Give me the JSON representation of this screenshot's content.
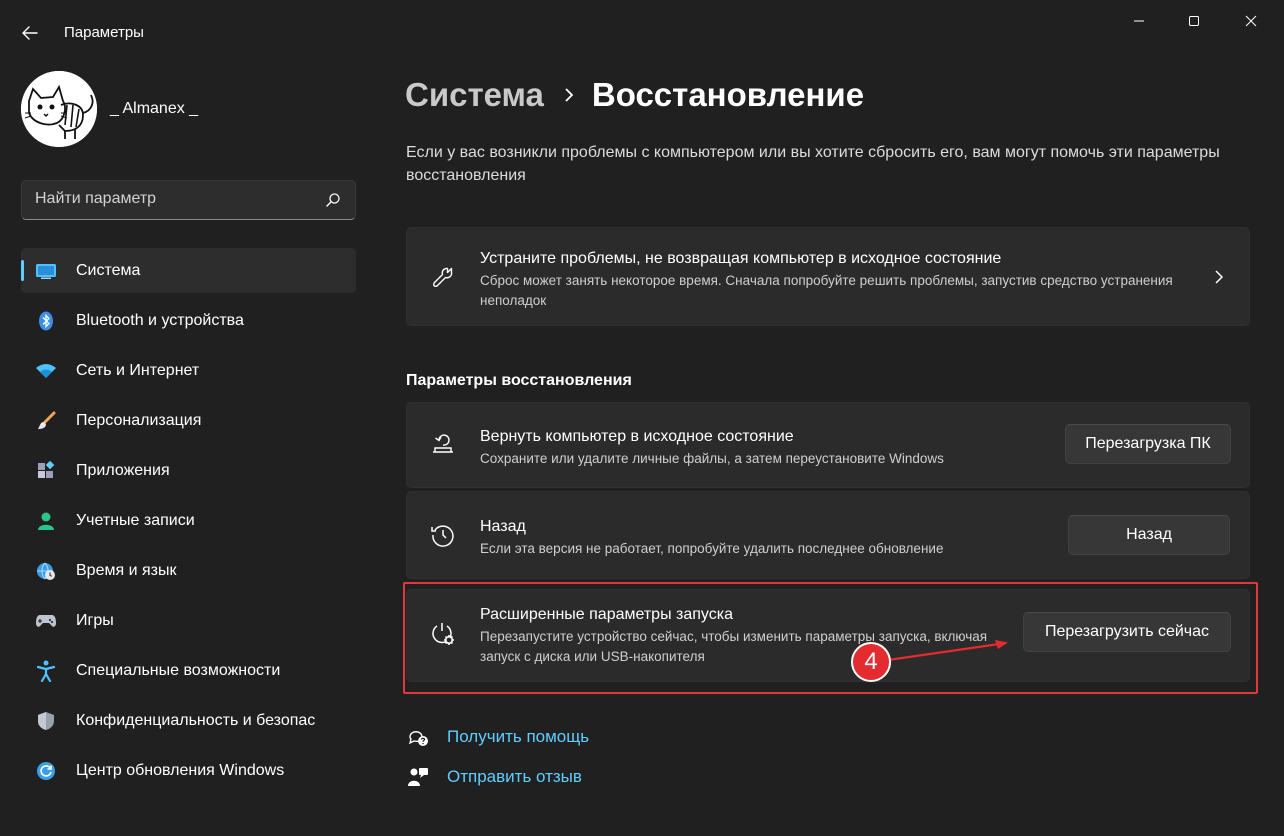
{
  "window": {
    "title": "Параметры",
    "controls": [
      "minimize",
      "maximize",
      "close"
    ]
  },
  "profile": {
    "name": "_ Almanex _"
  },
  "search": {
    "placeholder": "Найти параметр"
  },
  "sidebar": {
    "items": [
      {
        "label": "Система",
        "icon": "system-display-icon",
        "active": true
      },
      {
        "label": "Bluetooth и устройства",
        "icon": "bluetooth-icon"
      },
      {
        "label": "Сеть и Интернет",
        "icon": "wifi-icon"
      },
      {
        "label": "Персонализация",
        "icon": "brush-icon"
      },
      {
        "label": "Приложения",
        "icon": "apps-icon"
      },
      {
        "label": "Учетные записи",
        "icon": "user-icon"
      },
      {
        "label": "Время и язык",
        "icon": "globe-clock-icon"
      },
      {
        "label": "Игры",
        "icon": "gamepad-icon"
      },
      {
        "label": "Специальные возможности",
        "icon": "accessibility-icon"
      },
      {
        "label": "Конфиденциальность и безопас",
        "icon": "shield-icon"
      },
      {
        "label": "Центр обновления Windows",
        "icon": "update-icon"
      }
    ]
  },
  "breadcrumb": {
    "parent": "Система",
    "current": "Восстановление"
  },
  "description": "Если у вас возникли проблемы с компьютером или вы хотите сбросить его, вам могут помочь эти параметры восстановления",
  "troubleshoot_card": {
    "title": "Устраните проблемы, не возвращая компьютер в исходное состояние",
    "subtitle": "Сброс может занять некоторое время. Сначала попробуйте решить проблемы, запустив средство устранения неполадок",
    "icon": "wrench-icon"
  },
  "section_title": "Параметры восстановления",
  "recovery_options": [
    {
      "title": "Вернуть компьютер в исходное состояние",
      "subtitle": "Сохраните или удалите личные файлы, а затем переустановите Windows",
      "button": "Перезагрузка ПК",
      "icon": "reset-pc-icon"
    },
    {
      "title": "Назад",
      "subtitle": "Если эта версия не работает, попробуйте удалить последнее обновление",
      "button": "Назад",
      "icon": "history-icon"
    },
    {
      "title": "Расширенные параметры запуска",
      "subtitle": "Перезапустите устройство сейчас, чтобы изменить параметры запуска, включая запуск с диска или USB-накопителя",
      "button": "Перезагрузить сейчас",
      "icon": "power-settings-icon"
    }
  ],
  "annotation": {
    "step": "4",
    "color": "#e42b2f"
  },
  "links": [
    {
      "label": "Получить помощь",
      "icon": "help-icon"
    },
    {
      "label": "Отправить отзыв",
      "icon": "feedback-icon"
    }
  ],
  "colors": {
    "background": "#202020",
    "card": "#2b2b2b",
    "accent": "#60cdff",
    "highlight": "#e0383c"
  }
}
